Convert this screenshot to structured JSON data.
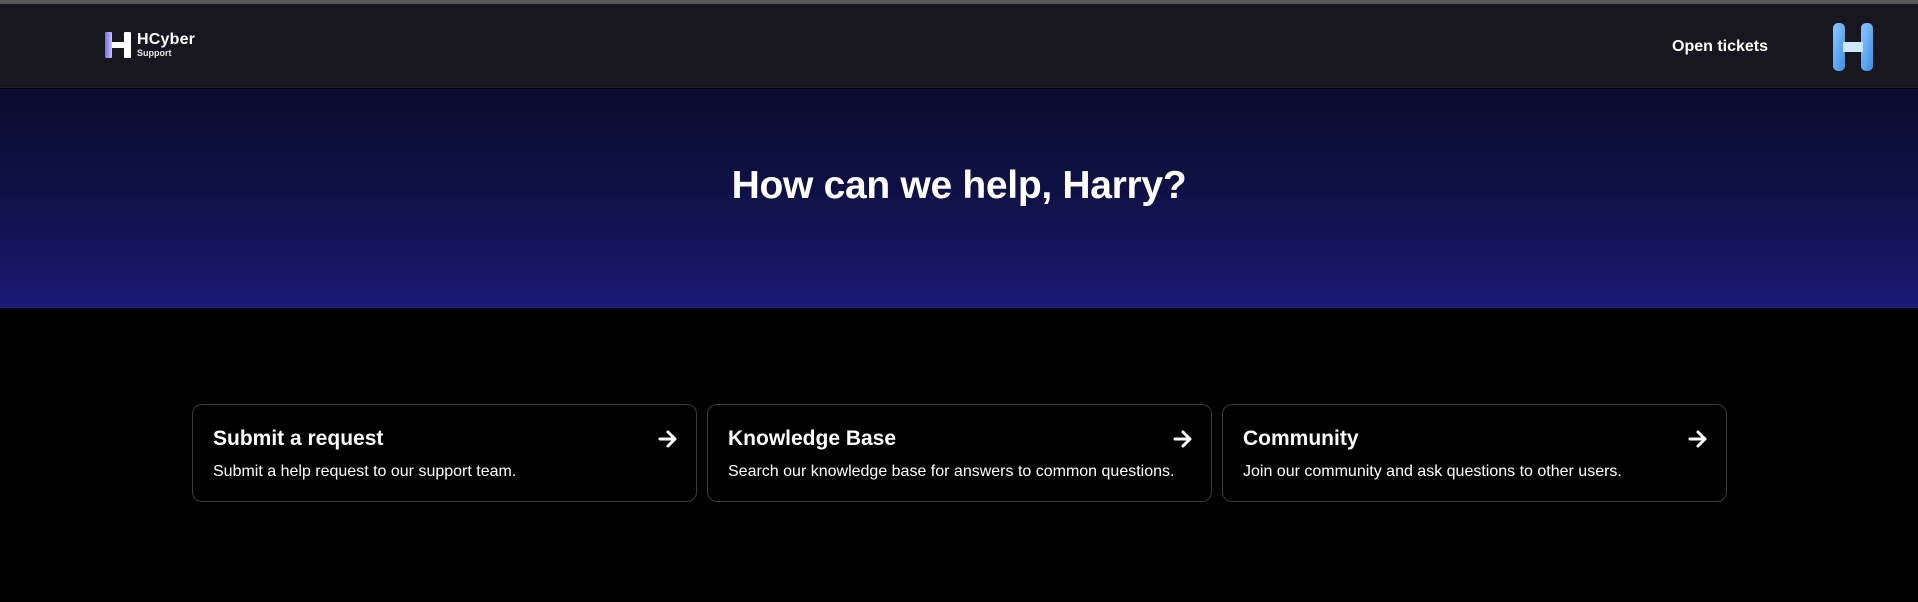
{
  "header": {
    "brand_name": "HCyber",
    "brand_sub": "Support",
    "nav_link": "Open tickets"
  },
  "hero": {
    "title": "How can we help, Harry?"
  },
  "cards": [
    {
      "title": "Submit a request",
      "description": "Submit a help request to our support team.",
      "icon": "arrow-right-icon"
    },
    {
      "title": "Knowledge Base",
      "description": "Search our knowledge base for answers to common questions.",
      "icon": "arrow-right-icon"
    },
    {
      "title": "Community",
      "description": "Join our community and ask questions to other users.",
      "icon": "arrow-right-icon"
    }
  ],
  "colors": {
    "header_bg": "#18171f",
    "hero_top": "#0a0b2e",
    "hero_bottom": "#1a1a78",
    "page_bg": "#000000",
    "avatar_accent": "#5aa8f0",
    "logo_accent": "#7b6cf0"
  },
  "icons": {
    "logo": "hcyber-logo-icon",
    "avatar": "user-avatar-icon"
  }
}
